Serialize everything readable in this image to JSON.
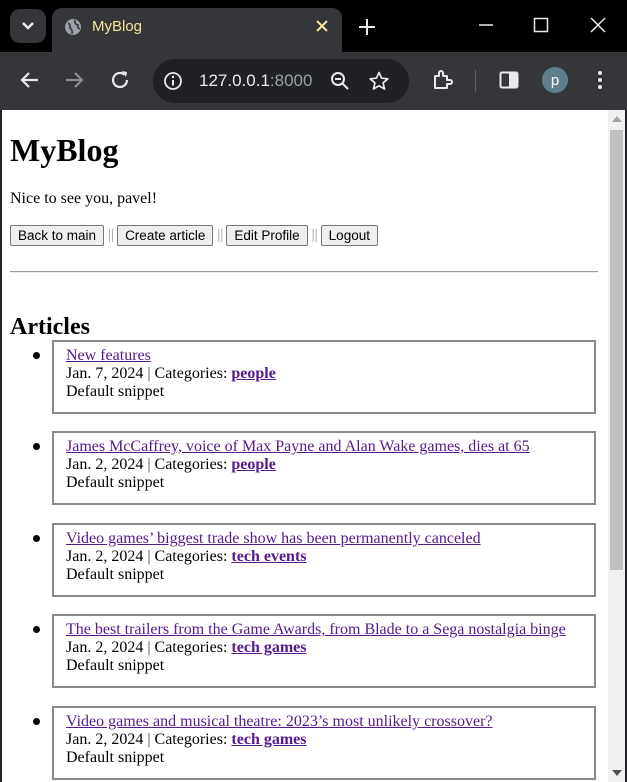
{
  "browser": {
    "tab_title": "MyBlog",
    "url_host": "127.0.0.1",
    "url_port": ":8000",
    "profile_initial": "p",
    "icons": [
      "tab-search-icon",
      "globe-icon",
      "close-icon",
      "plus-icon",
      "minimize-icon",
      "maximize-icon",
      "close-window-icon",
      "back-icon",
      "forward-icon",
      "reload-icon",
      "info-icon",
      "zoom-icon",
      "star-icon",
      "extensions-icon",
      "side-panel-icon",
      "menu-icon"
    ]
  },
  "page": {
    "site_title": "MyBlog",
    "greeting": "Nice to see you, pavel!",
    "nav": {
      "back_to_main": "Back to main",
      "create_article": "Create article",
      "edit_profile": "Edit Profile",
      "logout": "Logout",
      "separator": "||"
    },
    "articles_heading": "Articles",
    "categories_label": "Categories:",
    "articles": [
      {
        "title": "New features",
        "date": "Jan. 7, 2024",
        "categories": "people",
        "snippet": "Default snippet"
      },
      {
        "title": "James McCaffrey, voice of Max Payne and Alan Wake games, dies at 65",
        "date": "Jan. 2, 2024",
        "categories": "people",
        "snippet": "Default snippet"
      },
      {
        "title": "Video games’ biggest trade show has been permanently canceled",
        "date": "Jan. 2, 2024",
        "categories": "tech events",
        "snippet": "Default snippet"
      },
      {
        "title": "The best trailers from the Game Awards, from Blade to a Sega nostalgia binge",
        "date": "Jan. 2, 2024",
        "categories": "tech games",
        "snippet": "Default snippet"
      },
      {
        "title": "Video games and musical theatre: 2023’s most unlikely crossover?",
        "date": "Jan. 2, 2024",
        "categories": "tech games",
        "snippet": "Default snippet"
      }
    ]
  },
  "colors": {
    "tab_title": "#f7e39c",
    "link_visited": "#551a8b",
    "browser_bg": "#35363a"
  }
}
